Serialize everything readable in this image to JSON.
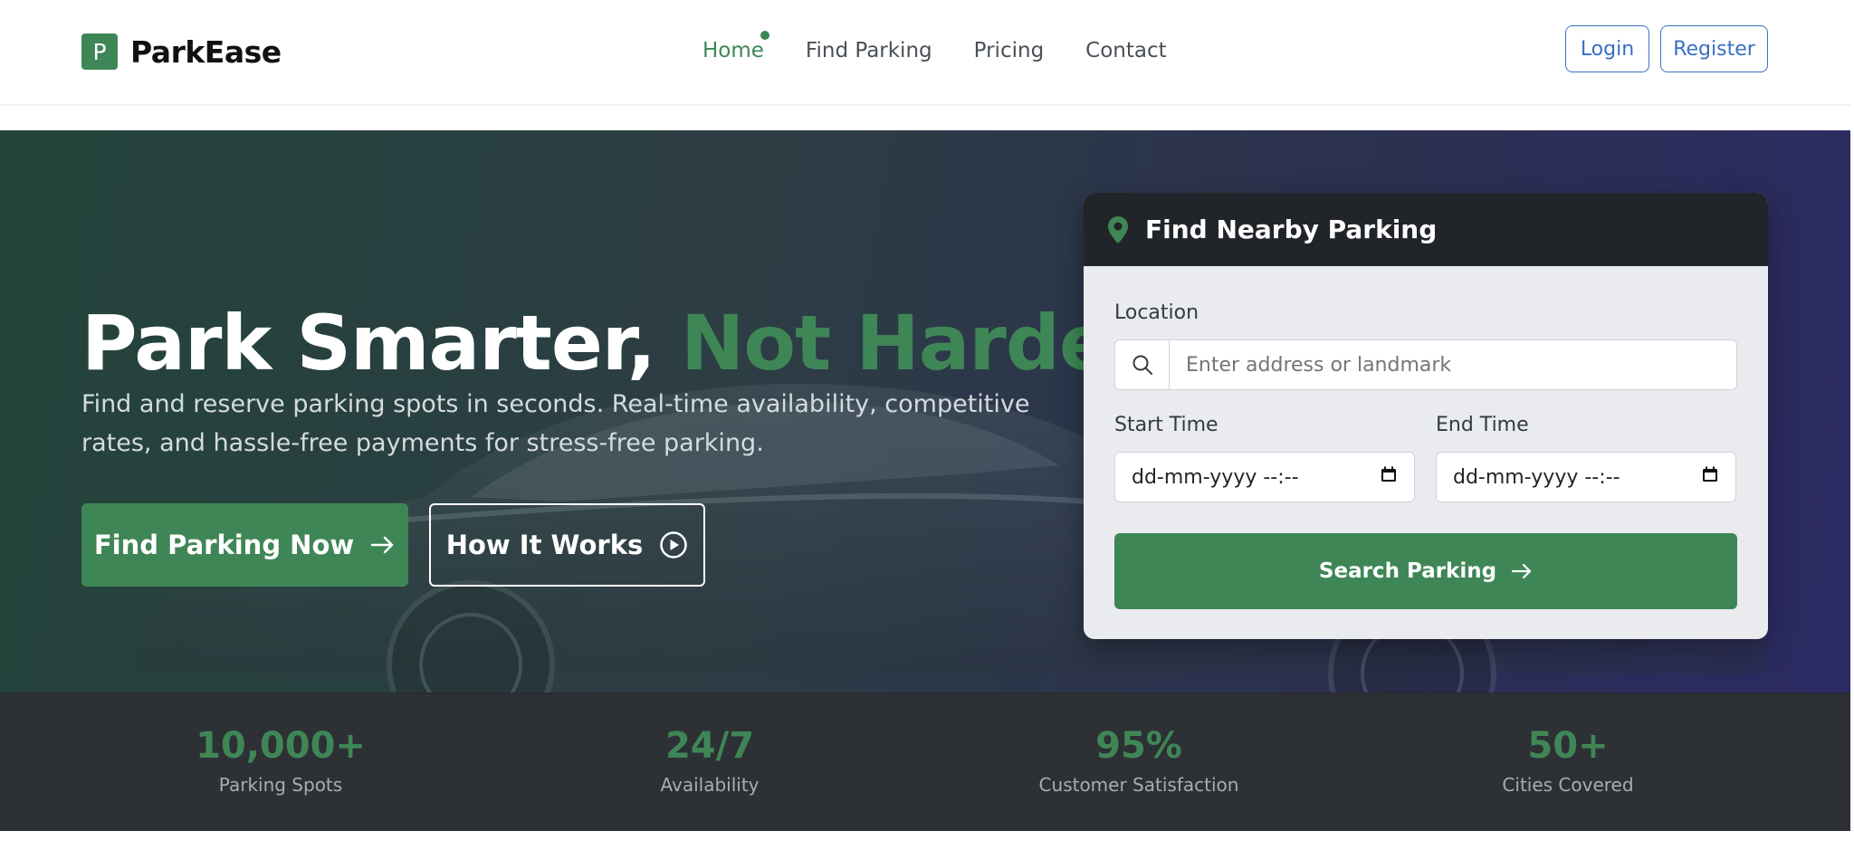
{
  "brand": {
    "logo_letter": "P",
    "name": "ParkEase",
    "accent_color": "#3f8656"
  },
  "nav": {
    "items": [
      {
        "label": "Home",
        "active": true
      },
      {
        "label": "Find Parking"
      },
      {
        "label": "Pricing"
      },
      {
        "label": "Contact"
      }
    ],
    "login_label": "Login",
    "register_label": "Register"
  },
  "hero": {
    "title_main": "Park Smarter,",
    "title_accent": "Not Harder",
    "subtitle": "Find and reserve parking spots in seconds. Real-time availability, competitive rates, and hassle-free payments for stress-free parking.",
    "primary_button": "Find Parking Now",
    "secondary_button": "How It Works"
  },
  "search": {
    "title": "Find Nearby Parking",
    "location_label": "Location",
    "location_placeholder": "Enter address or landmark",
    "start_label": "Start Time",
    "start_value": "dd-mm-yyyy --:--",
    "end_label": "End Time",
    "end_value": "dd-mm-yyyy --:--",
    "button": "Search Parking"
  },
  "stats": [
    {
      "value": "10,000+",
      "label": "Parking Spots"
    },
    {
      "value": "24/7",
      "label": "Availability"
    },
    {
      "value": "95%",
      "label": "Customer Satisfaction"
    },
    {
      "value": "50+",
      "label": "Cities Covered"
    }
  ]
}
